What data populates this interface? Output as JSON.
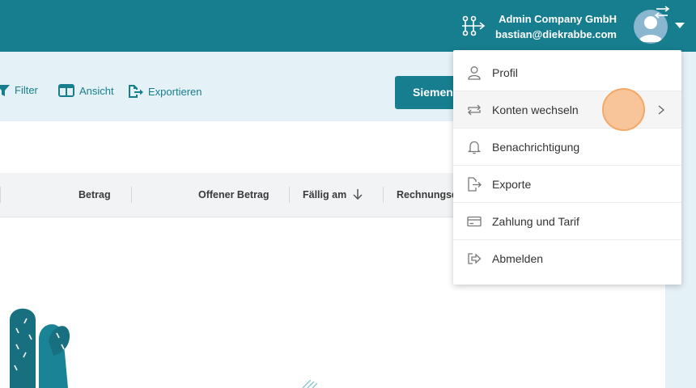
{
  "header": {
    "company_name": "Admin Company GmbH",
    "email": "bastian@diekrabbe.com"
  },
  "toolbar": {
    "filter_label": "Filter",
    "view_label": "Ansicht",
    "export_label": "Exportieren",
    "company_button_label": "Siemens"
  },
  "table": {
    "columns": [
      "Betrag",
      "Offener Betrag",
      "Fällig am",
      "Rechnungsd"
    ]
  },
  "account_menu": {
    "items": [
      {
        "label": "Profil",
        "icon": "person-icon"
      },
      {
        "label": "Konten wechseln",
        "icon": "switch-accounts-icon"
      },
      {
        "label": "Benachrichtigung",
        "icon": "bell-icon"
      },
      {
        "label": "Exporte",
        "icon": "file-export-icon"
      },
      {
        "label": "Zahlung und Tarif",
        "icon": "credit-card-icon"
      },
      {
        "label": "Abmelden",
        "icon": "logout-icon"
      }
    ]
  },
  "colors": {
    "brand": "#177e8f",
    "background": "#e4f1f7",
    "click_marker": "#f9b882"
  }
}
